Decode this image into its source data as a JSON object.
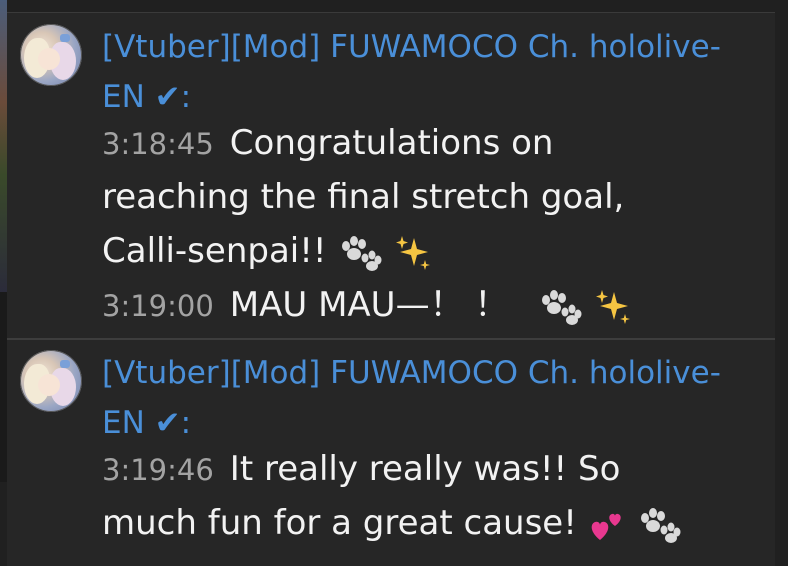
{
  "chat": {
    "messages": [
      {
        "author_name": "[Vtuber][Mod] FUWAMOCO Ch. hololive-EN",
        "author_suffix": ":",
        "verified_glyph": "✔",
        "lines": [
          {
            "timestamp": "3:18:45",
            "text_a": "Congratulations on",
            "text_b": "reaching the final stretch goal,",
            "text_c": "Calli-senpai!!",
            "emojis": [
              "paw-prints-icon",
              "sparkles-icon"
            ]
          },
          {
            "timestamp": "3:19:00",
            "text_a": "MAU MAU—！ ！",
            "emojis": [
              "paw-prints-icon",
              "sparkles-icon"
            ]
          }
        ]
      },
      {
        "author_name": "[Vtuber][Mod] FUWAMOCO Ch. hololive-EN",
        "author_suffix": ":",
        "verified_glyph": "✔",
        "lines": [
          {
            "timestamp": "3:19:46",
            "text_a": "It really really was!! So",
            "text_b": "much fun for a great cause!",
            "emojis": [
              "two-hearts-icon",
              "paw-prints-icon"
            ]
          }
        ]
      }
    ]
  },
  "colors": {
    "author": "#4a8fd8",
    "timestamp": "#a3a3a3",
    "message_text": "#f2f2f2",
    "background": "#262626"
  }
}
